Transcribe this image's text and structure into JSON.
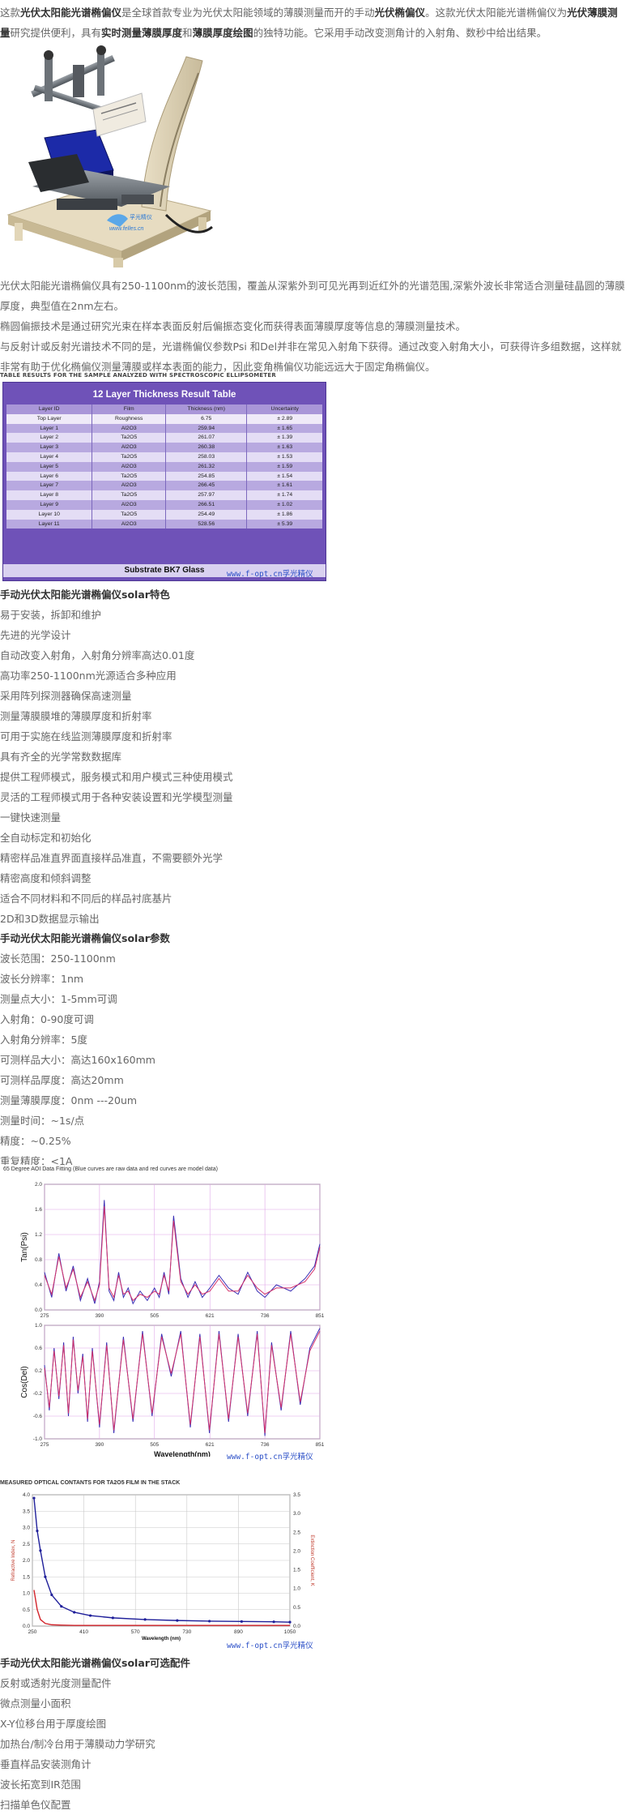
{
  "intro": {
    "pre": "这款",
    "b1": "光伏太阳能光谱椭偏仪",
    "mid1": "是全球首款专业为光伏太阳能领域的薄膜测量而开的手动",
    "b2": "光伏椭偏仪",
    "mid2": "。这款光伏太阳能光谱椭偏仪为",
    "b3": "光伏薄膜测量",
    "mid3": "研究提供便利，具有",
    "b4": "实时测量薄膜厚度",
    "mid4": "和",
    "b5": "薄膜厚度绘图",
    "post": "的独特功能。它采用手动改变测角计的入射角、数秒中给出结果。"
  },
  "device_logo": {
    "name": "孚光精仪",
    "url": "www.felles.cn"
  },
  "description": [
    "光伏太阳能光谱椭偏仪具有250-1100nm的波长范围，覆盖从深紫外到可见光再到近红外的光谱范围,深紫外波长非常适合测量硅晶圆的薄膜厚度，典型值在2nm左右。",
    "椭圆偏振技术是通过研究光束在样本表面反射后偏振态变化而获得表面薄膜厚度等信息的薄膜测量技术。",
    "与反射计或反射光谱技术不同的是，光谱椭偏仪参数Psi 和Del并非在常见入射角下获得。通过改变入射角大小，可获得许多组数据，这样就非常有助于优化椭偏仪测量薄膜或样本表面的能力，因此变角椭偏仪功能远远大于固定角椭偏仪。"
  ],
  "table_image": {
    "caption": "TABLE RESULTS FOR THE SAMPLE ANALYZED WITH SPECTROSCOPIC ELLIPSOMETER",
    "title": "12 Layer Thickness Result Table",
    "headers": [
      "Layer ID",
      "Film",
      "Thickness (nm)",
      "Uncertainty"
    ],
    "rows": [
      [
        "Top Layer",
        "Roughness",
        "6.75",
        "± 2.89"
      ],
      [
        "Layer 1",
        "Al2O3",
        "259.94",
        "± 1.65"
      ],
      [
        "Layer 2",
        "Ta2O5",
        "261.07",
        "± 1.39"
      ],
      [
        "Layer 3",
        "Al2O3",
        "260.38",
        "± 1.63"
      ],
      [
        "Layer 4",
        "Ta2O5",
        "258.03",
        "± 1.53"
      ],
      [
        "Layer 5",
        "Al2O3",
        "261.32",
        "± 1.59"
      ],
      [
        "Layer 6",
        "Ta2O5",
        "254.85",
        "± 1.54"
      ],
      [
        "Layer 7",
        "Al2O3",
        "266.45",
        "± 1.61"
      ],
      [
        "Layer 8",
        "Ta2O5",
        "257.97",
        "± 1.74"
      ],
      [
        "Layer 9",
        "Al2O3",
        "266.51",
        "± 1.02"
      ],
      [
        "Layer 10",
        "Ta2O5",
        "254.49",
        "± 1.86"
      ],
      [
        "Layer 11",
        "Al2O3",
        "528.56",
        "± 5.39"
      ]
    ],
    "footer": "Substrate BK7 Glass",
    "watermark": "www.f-opt.cn孚光精仪"
  },
  "features": {
    "heading": "手动光伏太阳能光谱椭偏仪solar特色",
    "items": [
      "易于安装，拆卸和维护",
      "先进的光学设计",
      "自动改变入射角，入射角分辨率高达0.01度",
      "高功率250-1100nm光源适合多种应用",
      "采用阵列探测器确保高速测量",
      "测量薄膜膜堆的薄膜厚度和折射率",
      "可用于实施在线监测薄膜厚度和折射率",
      "具有齐全的光学常数数据库",
      "提供工程师模式，服务模式和用户模式三种使用模式",
      "灵活的工程师模式用于各种安装设置和光学模型测量",
      "一键快速测量",
      "全自动标定和初始化",
      "精密样品准直界面直接样品准直，不需要额外光学",
      "精密高度和倾斜调整",
      "适合不同材料和不同后的样品衬底基片",
      "2D和3D数据显示输出"
    ]
  },
  "params": {
    "heading": "手动光伏太阳能光谱椭偏仪solar参数",
    "items": [
      "波长范围：250-1100nm",
      "波长分辨率：1nm",
      "测量点大小：1-5mm可调",
      "入射角：0-90度可调",
      "入射角分辨率：5度",
      "可测样品大小：高达160x160mm",
      "可测样品厚度：高达20mm",
      "测量薄膜厚度：0nm ---20um",
      "测量时间：~1s/点",
      "精度：~0.25%",
      "重复精度：<1A"
    ]
  },
  "chart_data": [
    {
      "type": "line",
      "title": "65 Degree AOI Data Fitting (Blue curves are raw data and red curves are model data)",
      "xlabel": "",
      "ylabel": "Tan(Psi)",
      "xlim": [
        275,
        851
      ],
      "ylim": [
        0,
        2.0
      ],
      "xticks": [
        275,
        390,
        505,
        621,
        736,
        851
      ],
      "yticks": [
        "0.0",
        "0.4",
        "0.8",
        "1.2",
        "1.6",
        "2.0"
      ],
      "x": [
        275,
        290,
        305,
        320,
        335,
        350,
        365,
        380,
        390,
        400,
        410,
        420,
        430,
        440,
        450,
        460,
        475,
        490,
        505,
        515,
        525,
        535,
        545,
        560,
        575,
        590,
        605,
        621,
        640,
        660,
        680,
        700,
        720,
        736,
        760,
        790,
        820,
        840,
        851
      ],
      "series": [
        {
          "values": [
            0.6,
            0.2,
            0.9,
            0.3,
            0.7,
            0.15,
            0.5,
            0.1,
            0.45,
            1.75,
            0.3,
            0.15,
            0.6,
            0.2,
            0.35,
            0.1,
            0.3,
            0.15,
            0.35,
            0.2,
            0.6,
            0.25,
            1.5,
            0.5,
            0.2,
            0.45,
            0.2,
            0.35,
            0.55,
            0.35,
            0.25,
            0.6,
            0.3,
            0.2,
            0.4,
            0.3,
            0.5,
            0.7,
            1.05
          ]
        },
        {
          "values": [
            0.55,
            0.25,
            0.85,
            0.35,
            0.65,
            0.2,
            0.45,
            0.15,
            0.4,
            1.65,
            0.35,
            0.2,
            0.55,
            0.25,
            0.3,
            0.15,
            0.25,
            0.2,
            0.3,
            0.25,
            0.55,
            0.3,
            1.42,
            0.45,
            0.25,
            0.4,
            0.25,
            0.3,
            0.5,
            0.3,
            0.3,
            0.55,
            0.35,
            0.25,
            0.35,
            0.35,
            0.45,
            0.65,
            1.0
          ]
        }
      ]
    },
    {
      "type": "line",
      "title": "",
      "xlabel": "Wavelength(nm)",
      "ylabel": "Cos(Del)",
      "xlim": [
        275,
        851
      ],
      "ylim": [
        -1.0,
        1.0
      ],
      "xticks": [
        275,
        390,
        505,
        621,
        736,
        851
      ],
      "yticks": [
        "-1.0",
        "-0.6",
        "-0.2",
        "0.2",
        "0.6",
        "1.0"
      ],
      "x": [
        275,
        285,
        295,
        305,
        315,
        325,
        335,
        345,
        355,
        365,
        375,
        390,
        405,
        420,
        440,
        460,
        480,
        500,
        520,
        540,
        560,
        580,
        600,
        620,
        640,
        660,
        680,
        700,
        720,
        736,
        750,
        770,
        790,
        810,
        830,
        851
      ],
      "series": [
        {
          "values": [
            0.3,
            -0.5,
            0.6,
            -0.3,
            0.7,
            -0.6,
            0.8,
            -0.2,
            0.5,
            -0.7,
            0.6,
            -0.8,
            0.7,
            -0.9,
            0.8,
            -0.7,
            0.9,
            -0.6,
            0.85,
            0.1,
            0.9,
            -0.8,
            0.85,
            -0.9,
            0.9,
            -0.7,
            0.85,
            -0.6,
            0.9,
            -0.95,
            0.7,
            -0.5,
            0.9,
            -0.4,
            0.6,
            0.95
          ]
        },
        {
          "values": [
            0.25,
            -0.45,
            0.55,
            -0.25,
            0.65,
            -0.55,
            0.75,
            -0.15,
            0.45,
            -0.65,
            0.55,
            -0.75,
            0.65,
            -0.85,
            0.75,
            -0.65,
            0.85,
            -0.55,
            0.8,
            0.15,
            0.85,
            -0.75,
            0.8,
            -0.85,
            0.85,
            -0.65,
            0.8,
            -0.55,
            0.85,
            -0.9,
            0.65,
            -0.45,
            0.85,
            -0.35,
            0.55,
            0.9
          ]
        }
      ]
    },
    {
      "type": "line",
      "title": "MEASURED OPTICAL CONTANTS FOR TA2O5 FILM IN THE STACK",
      "xlabel": "Wavelength (nm)",
      "ylabel": "Refractive Index, N",
      "ylabel_right": "Extinction Coefficient, K",
      "xlim": [
        250,
        1050
      ],
      "ylim": [
        0,
        4.0
      ],
      "ylim_right": [
        0,
        3.5
      ],
      "xticks": [
        250,
        410,
        570,
        730,
        890,
        1050
      ],
      "yticks": [
        "0.0",
        "0.5",
        "1.0",
        "1.5",
        "2.0",
        "2.5",
        "3.0",
        "3.5",
        "4.0"
      ],
      "yticks_right": [
        "0.0",
        "0.5",
        "1.0",
        "1.5",
        "2.0",
        "2.5",
        "3.0",
        "3.5"
      ],
      "x": [
        255,
        265,
        275,
        290,
        310,
        340,
        380,
        430,
        500,
        600,
        700,
        800,
        900,
        1000,
        1050
      ],
      "series": [
        {
          "name": "N",
          "values": [
            3.9,
            2.9,
            2.3,
            1.5,
            0.95,
            0.6,
            0.42,
            0.32,
            0.25,
            0.2,
            0.17,
            0.15,
            0.14,
            0.13,
            0.12
          ]
        },
        {
          "name": "K",
          "values": [
            1.1,
            0.5,
            0.2,
            0.08,
            0.04,
            0.03,
            0.02,
            0.02,
            0.02,
            0.02,
            0.02,
            0.02,
            0.02,
            0.02,
            0.02
          ]
        }
      ]
    }
  ],
  "chart_watermark": "www.f-opt.cn孚光精仪",
  "accessories": {
    "heading": "手动光伏太阳能光谱椭偏仪solar可选配件",
    "items": [
      "反射或透射光度测量配件",
      "微点测量小面积",
      "X-Y位移台用于厚度绘图",
      "加热台/制冷台用于薄膜动力学研究",
      "垂直样品安装测角计",
      "波长拓宽到IR范围",
      "扫描单色仪配置"
    ]
  },
  "colors": {
    "table_purple": "#6f52b8",
    "raw_curve": "#3a2fb5",
    "model_curve": "#d4326a",
    "watermark_blue": "#2b4fc7"
  }
}
